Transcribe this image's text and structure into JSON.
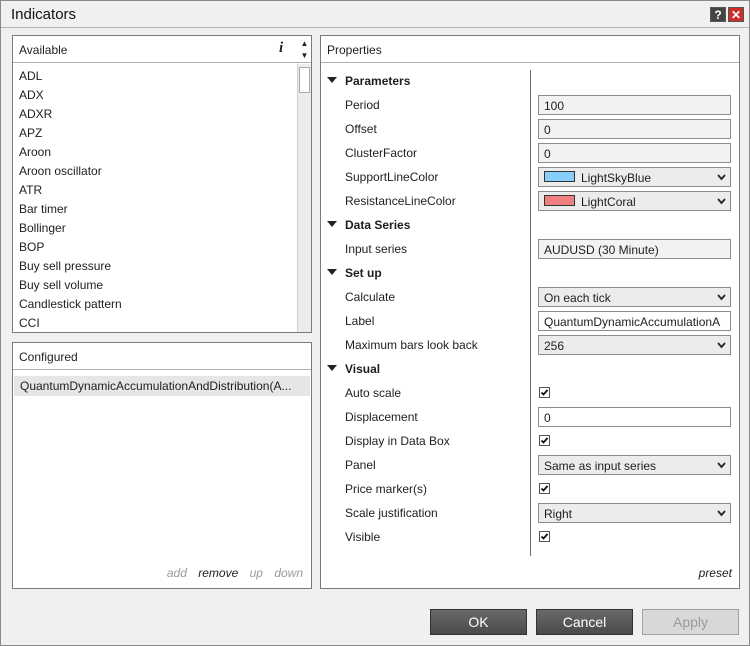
{
  "window": {
    "title": "Indicators"
  },
  "available": {
    "title": "Available",
    "items": [
      "ADL",
      "ADX",
      "ADXR",
      "APZ",
      "Aroon",
      "Aroon oscillator",
      "ATR",
      "Bar timer",
      "Bollinger",
      "BOP",
      "Buy sell pressure",
      "Buy sell volume",
      "Candlestick pattern",
      "CCI"
    ]
  },
  "configured": {
    "title": "Configured",
    "items": [
      "QuantumDynamicAccumulationAndDistribution(A..."
    ],
    "actions": {
      "add": "add",
      "remove": "remove",
      "up": "up",
      "down": "down"
    }
  },
  "properties": {
    "title": "Properties",
    "preset": "preset",
    "categories": {
      "parameters": "Parameters",
      "data_series": "Data Series",
      "setup": "Set up",
      "visual": "Visual"
    },
    "rows": {
      "period": {
        "label": "Period",
        "value": "100"
      },
      "offset": {
        "label": "Offset",
        "value": "0"
      },
      "cluster_factor": {
        "label": "ClusterFactor",
        "value": "0"
      },
      "support_line_color": {
        "label": "SupportLineColor",
        "value": "LightSkyBlue",
        "swatch": "#87CEFA"
      },
      "resistance_line_color": {
        "label": "ResistanceLineColor",
        "value": "LightCoral",
        "swatch": "#F08080"
      },
      "input_series": {
        "label": "Input series",
        "value": "AUDUSD (30 Minute)"
      },
      "calculate": {
        "label": "Calculate",
        "value": "On each tick"
      },
      "label": {
        "label": "Label",
        "value": "QuantumDynamicAccumulationA"
      },
      "max_bars": {
        "label": "Maximum bars look back",
        "value": "256"
      },
      "auto_scale": {
        "label": "Auto scale",
        "checked": true
      },
      "displacement": {
        "label": "Displacement",
        "value": "0"
      },
      "display_data_box": {
        "label": "Display in Data Box",
        "checked": true
      },
      "panel": {
        "label": "Panel",
        "value": "Same as input series"
      },
      "price_markers": {
        "label": "Price marker(s)",
        "checked": true
      },
      "scale_justification": {
        "label": "Scale justification",
        "value": "Right"
      },
      "visible": {
        "label": "Visible",
        "checked": true
      }
    }
  },
  "buttons": {
    "ok": "OK",
    "cancel": "Cancel",
    "apply": "Apply"
  }
}
